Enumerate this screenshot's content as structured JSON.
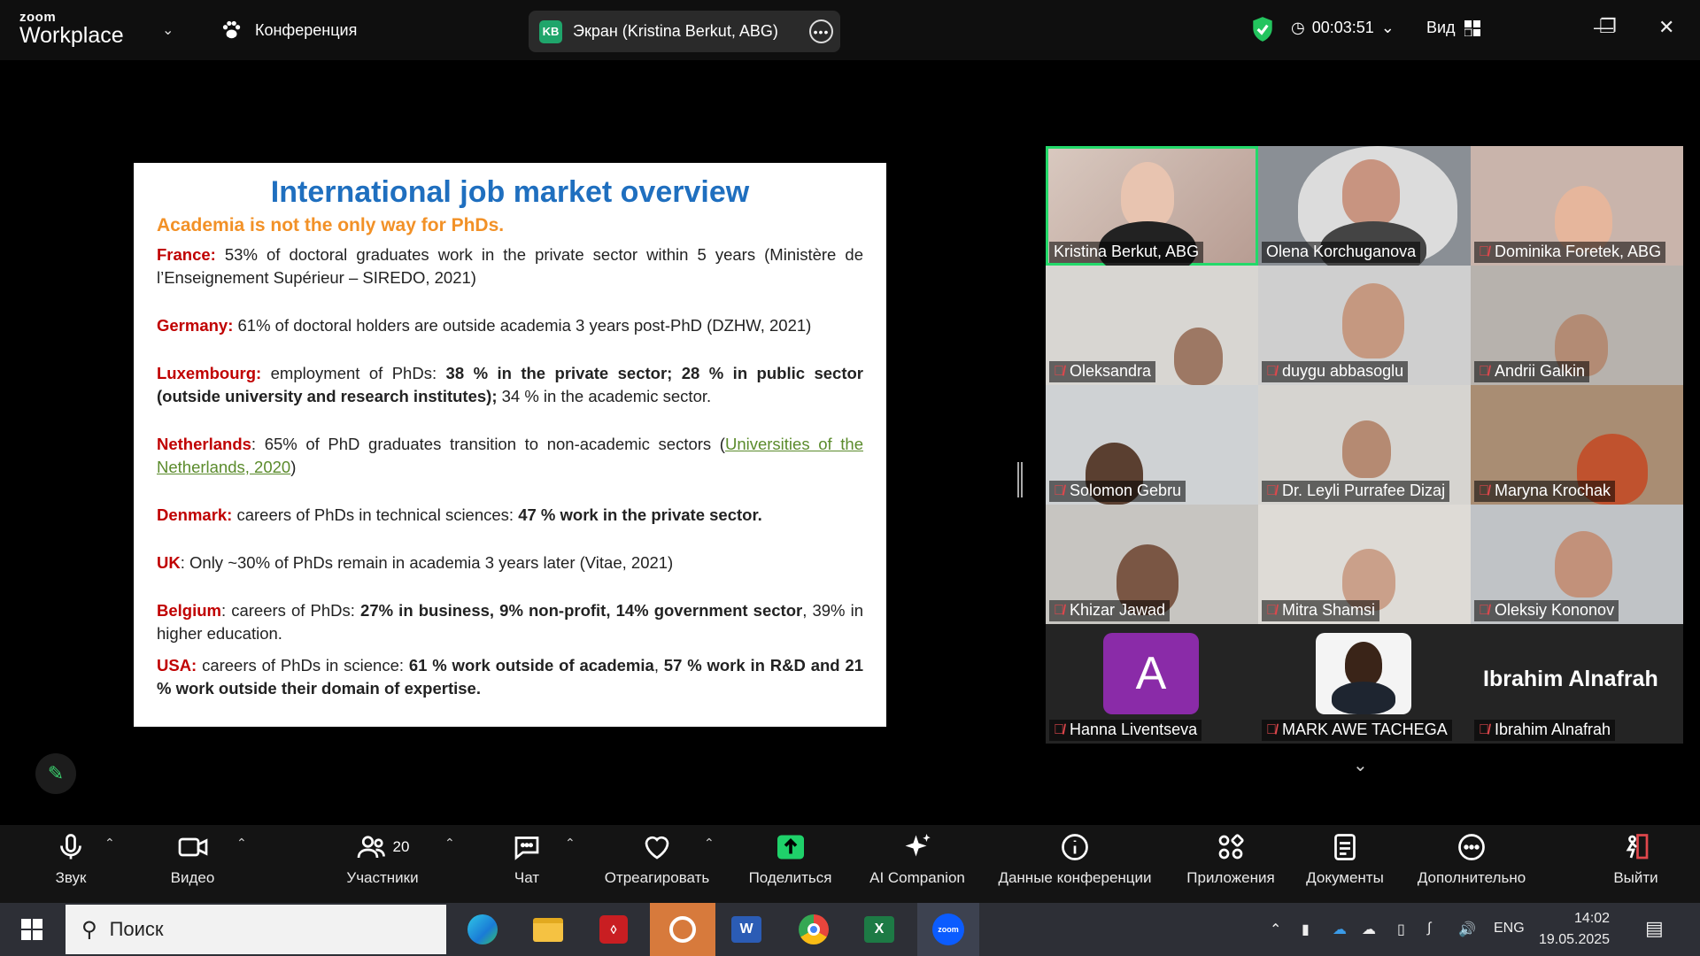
{
  "app": {
    "brand_top": "zoom",
    "brand_bottom": "Workplace",
    "meeting_label": "Конференция",
    "share_initials": "KB",
    "share_label": "Экран (Kristina Berkut, ABG)",
    "timer": "00:03:51",
    "view_label": "Вид"
  },
  "slide": {
    "title": "International job market overview",
    "subtitle": "Academia is not the only way for PhDs.",
    "items": [
      {
        "country": "France:",
        "text": " 53% of doctoral graduates work in the private sector within 5 years (Ministère de l’Enseignement Supérieur – SIREDO, 2021)"
      },
      {
        "country": "Germany:",
        "text": " 61% of doctoral holders are outside academia 3 years post-PhD (DZHW, 2021)"
      },
      {
        "country": "Luxembourg:",
        "text": " employment of PhDs: ",
        "bold": "38 % in the private sector; 28 % in public sector (outside university and research institutes);",
        "tail": " 34 % in the academic sector."
      },
      {
        "country": "Netherlands",
        "text": ": 65% of PhD graduates transition to non-academic sectors (",
        "link": "Universities of the Netherlands, 2020",
        "tail": ")"
      },
      {
        "country": "Denmark:",
        "text": " careers of PhDs in technical sciences: ",
        "bold": "47 % work in the private sector."
      },
      {
        "country": "UK",
        "text": ": Only ~30% of PhDs remain in academia 3 years later (Vitae, 2021)"
      },
      {
        "country": "Belgium",
        "text": ": careers of PhDs: ",
        "bold": "27% in business, 9% non-profit, 14% government sector",
        "tail": ", 39% in higher education."
      },
      {
        "country": "USA:",
        "text": " careers of PhDs in science: ",
        "bold": "61 % work outside of academia",
        "tail": ", ",
        "bold2": "57 % work in R&D and 21 % work outside their domain of expertise."
      }
    ]
  },
  "participants": [
    {
      "name": "Kristina Berkut, ABG",
      "muted": false
    },
    {
      "name": "Olena Korchuganova",
      "muted": false
    },
    {
      "name": "Dominika Foretek, ABG",
      "muted": true
    },
    {
      "name": "Oleksandra",
      "muted": true
    },
    {
      "name": "duygu abbasoglu",
      "muted": true
    },
    {
      "name": "Andrii Galkin",
      "muted": true
    },
    {
      "name": "Solomon Gebru",
      "muted": true
    },
    {
      "name": "Dr. Leyli  Purrafee Dizaj",
      "muted": true
    },
    {
      "name": "Maryna Krochak",
      "muted": true
    },
    {
      "name": "Khizar Jawad",
      "muted": true
    },
    {
      "name": "Mitra Shamsi",
      "muted": true
    },
    {
      "name": "Oleksiy Kononov",
      "muted": true
    },
    {
      "name": "Hanna Liventseva",
      "muted": true,
      "avatar": "A"
    },
    {
      "name": "MARK AWE TACHEGA",
      "muted": true
    },
    {
      "name": "Ibrahim Alnafrah",
      "muted": true,
      "display_name": "Ibrahim Alnafrah"
    }
  ],
  "toolbar": {
    "audio": "Звук",
    "video": "Видео",
    "participants": "Участники",
    "participants_count": "20",
    "chat": "Чат",
    "react": "Отреагировать",
    "share": "Поделиться",
    "ai": "AI Companion",
    "info": "Данные конференции",
    "apps": "Приложения",
    "docs": "Документы",
    "more": "Дополнительно",
    "leave": "Выйти"
  },
  "taskbar": {
    "search_placeholder": "Поиск",
    "lang": "ENG",
    "time": "14:02",
    "date": "19.05.2025"
  },
  "colors": {
    "active_speaker": "#23d96a",
    "title_blue": "#1f6fbf",
    "subtitle_orange": "#f29127",
    "country_red": "#c00000",
    "muted_red": "#e0474c"
  }
}
